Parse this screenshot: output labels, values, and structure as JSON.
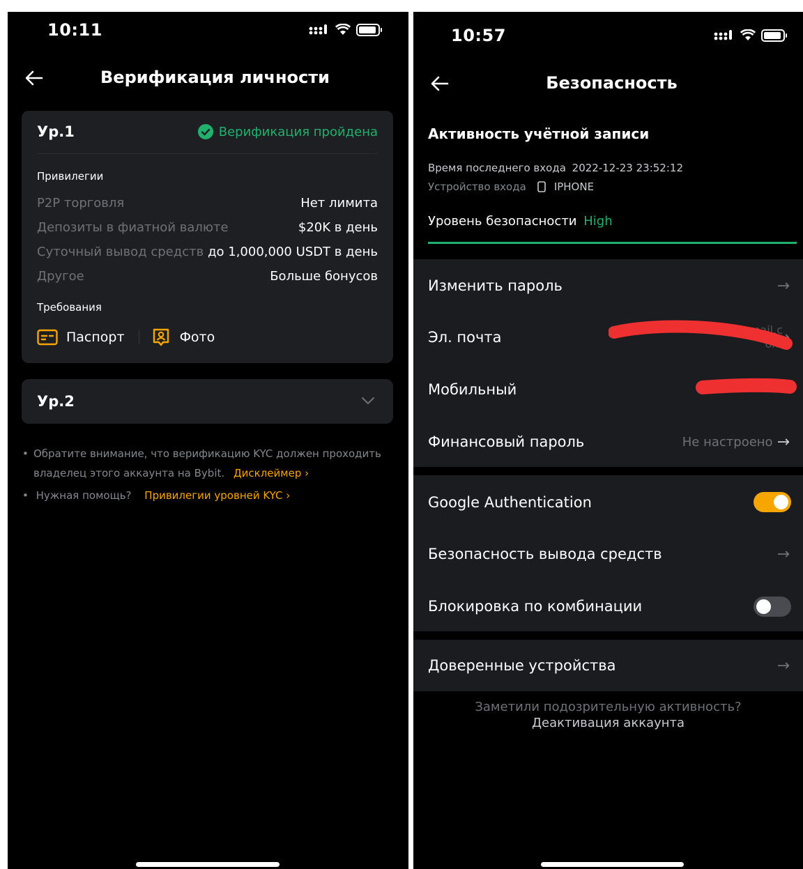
{
  "left": {
    "status_time": "10:11",
    "title": "Верификация личности",
    "level1": {
      "name": "Ур.1",
      "status": "Верификация пройдена",
      "privileges_heading": "Привилегии",
      "privileges": [
        {
          "label": "P2P торговля",
          "value": "Нет лимита"
        },
        {
          "label": "Депозиты в фиатной валюте",
          "value": "$20K в день"
        },
        {
          "label": "Суточный вывод средств",
          "value": "до 1,000,000 USDT в день"
        },
        {
          "label": "Другое",
          "value": "Больше бонусов"
        }
      ],
      "requirements_heading": "Требования",
      "requirements": [
        {
          "label": "Паспорт",
          "icon": "passport-icon"
        },
        {
          "label": "Фото",
          "icon": "photo-icon"
        }
      ]
    },
    "level2": {
      "name": "Ур.2"
    },
    "notes": {
      "note1_text": "Обратите внимание, что верификацию KYC должен проходить владелец этого аккаунта на Bybit.",
      "note1_link": "Дисклеймер",
      "note2_text": "Нужная помощь?",
      "note2_link": "Привилегии уровней KYC"
    }
  },
  "right": {
    "status_time": "10:57",
    "title": "Безопасность",
    "activity": {
      "heading": "Активность учётной записи",
      "last_login_label": "Время последнего входа",
      "last_login_value": "2022-12-23 23:52:12",
      "device_label": "Устройство входа",
      "device_value": "IPHONE",
      "security_label": "Уровень безопасности",
      "security_value": "High",
      "security_level": 1.0
    },
    "group1": [
      {
        "label": "Изменить пароль",
        "value": ""
      },
      {
        "label": "Эл. почта",
        "value": "mail.c om"
      },
      {
        "label": "Мобильный",
        "value": ""
      },
      {
        "label": "Финансовый пароль",
        "value": "Не настроено"
      }
    ],
    "group2": [
      {
        "label": "Google Authentication",
        "toggle": true
      },
      {
        "label": "Безопасность вывода средств"
      },
      {
        "label": "Блокировка по комбинации",
        "toggle": false
      }
    ],
    "group3": [
      {
        "label": "Доверенные устройства"
      }
    ],
    "footer": {
      "question": "Заметили подозрительную активность?",
      "link": "Деактивация аккаунта"
    }
  },
  "colors": {
    "background": "#000000",
    "card": "#1e1f23",
    "accent_orange": "#f7a600",
    "success_green": "#20b26c",
    "muted": "#6f7178"
  }
}
